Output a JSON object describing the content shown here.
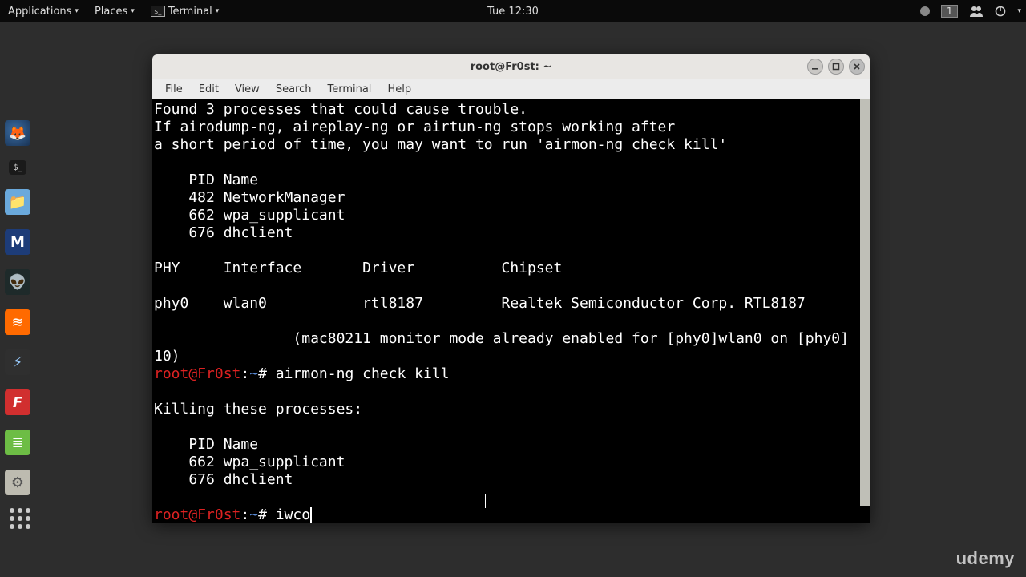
{
  "topbar": {
    "applications": "Applications",
    "places": "Places",
    "terminal": "Terminal",
    "clock": "Tue 12:30",
    "workspace_badge": "1"
  },
  "launcher": {
    "items": [
      {
        "name": "firefox-icon",
        "bg": "#e66000",
        "glyph": "🦊"
      },
      {
        "name": "term-small-icon",
        "bg": "#222222",
        "glyph": "$_"
      },
      {
        "name": "files-icon",
        "bg": "#3d84c6",
        "glyph": "📁"
      },
      {
        "name": "metasploit-icon",
        "bg": "#1d3c78",
        "glyph": "M"
      },
      {
        "name": "armitage-icon",
        "bg": "#2aa198",
        "glyph": "👽"
      },
      {
        "name": "burp-icon",
        "bg": "#ff6a00",
        "glyph": "≋"
      },
      {
        "name": "zenmap-icon",
        "bg": "#333333",
        "glyph": "⚡"
      },
      {
        "name": "faraday-icon",
        "bg": "#d12f2f",
        "glyph": "F"
      },
      {
        "name": "leafpad-icon",
        "bg": "#6dbd45",
        "glyph": "≣"
      },
      {
        "name": "tweaks-icon",
        "bg": "#8a8a84",
        "glyph": "⚙"
      }
    ]
  },
  "window": {
    "title": "root@Fr0st: ~",
    "menubar": [
      "File",
      "Edit",
      "View",
      "Search",
      "Terminal",
      "Help"
    ]
  },
  "terminal": {
    "l1": "Found 3 processes that could cause trouble.",
    "l2": "If airodump-ng, aireplay-ng or airtun-ng stops working after",
    "l3": "a short period of time, you may want to run 'airmon-ng check kill'",
    "l4": "",
    "l5": "    PID Name",
    "l6": "    482 NetworkManager",
    "l7": "    662 wpa_supplicant",
    "l8": "    676 dhclient",
    "l9": "",
    "l10": "PHY     Interface       Driver          Chipset",
    "l11": "",
    "l12": "phy0    wlan0           rtl8187         Realtek Semiconductor Corp. RTL8187",
    "l13": "",
    "l14": "                (mac80211 monitor mode already enabled for [phy0]wlan0 on [phy0]",
    "l15": "10)",
    "p1_user": "root@Fr0st",
    "p1_sep": ":",
    "p1_path": "~",
    "p1_hash": "# ",
    "p1_cmd": "airmon-ng check kill",
    "l17": "",
    "l18": "Killing these processes:",
    "l19": "",
    "l20": "    PID Name",
    "l21": "    662 wpa_supplicant",
    "l22": "    676 dhclient",
    "l23": "",
    "p2_user": "root@Fr0st",
    "p2_sep": ":",
    "p2_path": "~",
    "p2_hash": "# ",
    "p2_cmd": "iwco"
  },
  "watermark": "udemy"
}
